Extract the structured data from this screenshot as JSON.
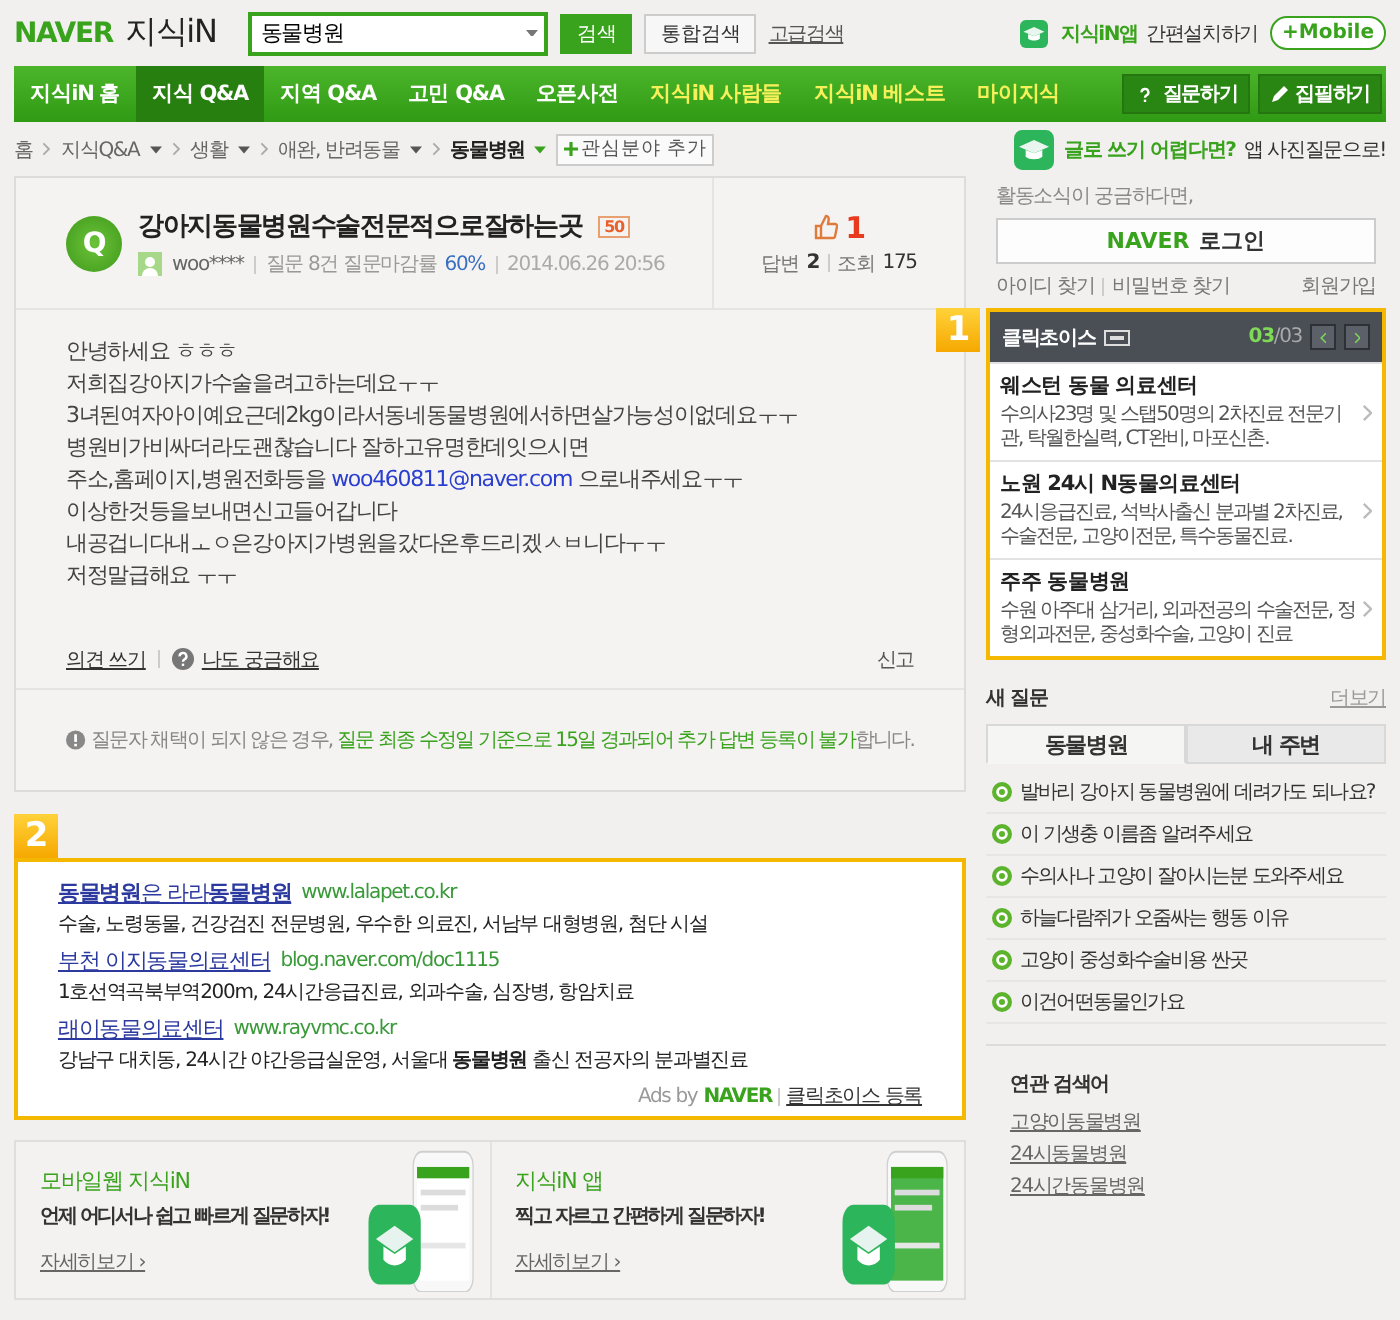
{
  "header": {
    "logo": "NAVER",
    "service": "지식iN",
    "search": {
      "value": "동물병원"
    },
    "search_button": "검색",
    "total_button": "통합검색",
    "advanced_link": "고급검색",
    "app_name": "지식iN앱",
    "app_install": "간편설치하기",
    "mobile": "+Mobile"
  },
  "nav": {
    "items": [
      {
        "label": "지식iN 홈",
        "selected": false,
        "highlighted": false
      },
      {
        "label": "지식 Q&A",
        "selected": true,
        "highlighted": false
      },
      {
        "label": "지역 Q&A",
        "selected": false,
        "highlighted": false
      },
      {
        "label": "고민 Q&A",
        "selected": false,
        "highlighted": false
      },
      {
        "label": "오픈사전",
        "selected": false,
        "highlighted": false
      },
      {
        "label": "지식iN 사람들",
        "selected": false,
        "highlighted": true
      },
      {
        "label": "지식iN 베스트",
        "selected": false,
        "highlighted": true
      },
      {
        "label": "마이지식",
        "selected": false,
        "highlighted": true
      }
    ],
    "actions": [
      {
        "kind": "ask",
        "label": "질문하기"
      },
      {
        "kind": "write",
        "label": "집필하기"
      }
    ]
  },
  "breadcrumb": {
    "items": [
      {
        "label": "홈",
        "dropdown": false,
        "selected": false
      },
      {
        "label": "지식Q&A",
        "dropdown": true,
        "selected": false
      },
      {
        "label": "생활",
        "dropdown": true,
        "selected": false
      },
      {
        "label": "애완, 반려동물",
        "dropdown": true,
        "selected": false
      },
      {
        "label": "동물병원",
        "dropdown": true,
        "selected": true
      }
    ],
    "add_interest": "관심분야 추가"
  },
  "app_tip": {
    "highlight": "글로 쓰기 어렵다면?",
    "text": "앱 사진질문으로!"
  },
  "question": {
    "icon_letter": "Q",
    "title": "강아지동물병원수술전문적으로잘하는곳",
    "points": "50",
    "user": "woo****",
    "stats_label": "질문 8건 질문마감률",
    "close_rate": "60%",
    "date": "2014.06.26 20:56",
    "likes": "1",
    "answers_label": "답변",
    "answers": "2",
    "views_label": "조회",
    "views": "175",
    "body": [
      [
        {
          "kind": "text",
          "text": "안녕하세요 ㅎㅎㅎ"
        }
      ],
      [
        {
          "kind": "text",
          "text": "저희집강아지가수술을려고하는데요ㅜㅜ"
        }
      ],
      [
        {
          "kind": "text",
          "text": "3녀된여자아이예요근데2kg이라서동네동물병원에서하면살가능성이없데요ㅜㅜ"
        }
      ],
      [
        {
          "kind": "text",
          "text": "병원비가비싸더라도괜찮습니다 잘하고유명한데잇으시면"
        }
      ],
      [
        {
          "kind": "text",
          "text": "주소,홈페이지,병원전화등을 "
        },
        {
          "kind": "link",
          "text": "woo460811@naver.com"
        },
        {
          "kind": "text",
          "text": " 으로내주세요ㅜㅜ"
        }
      ],
      [
        {
          "kind": "text",
          "text": "이상한것등을보내면신고들어갑니다"
        }
      ],
      [
        {
          "kind": "text",
          "text": "내공겁니다내ㅗㅇ은강아지가병원을갔다온후드리겠ㅅㅂ니다ㅜㅜ"
        }
      ],
      [
        {
          "kind": "text",
          "text": "저정말급해요 ㅜㅜ"
        }
      ]
    ],
    "comment_link": "의견 쓰기",
    "curious_link": "나도 궁금해요",
    "report": "신고",
    "notice": {
      "text": "질문자 채택이 되지 않은 경우, ",
      "highlight": "질문 최종 수정일 기준으로 15일 경과되어 추가 답변 등록이 불가",
      "end": "합니다."
    }
  },
  "login": {
    "prompt": "활동소식이 궁금하다면,",
    "brand": "NAVER",
    "button": "로그인",
    "links": [
      "아이디 찾기",
      "비밀번호 찾기"
    ],
    "signup": "회원가입"
  },
  "clickchoice": {
    "marker": "1",
    "title": "클릭초이스",
    "page_current": "03",
    "page_total": "/03",
    "items": [
      {
        "title": "웨스턴 동물 의료센터",
        "desc": "수의사23명 및 스탭50명의 2차진료 전문기관, 탁월한실력, CT완비, 마포신촌."
      },
      {
        "title": "노원 24시 N동물의료센터",
        "desc": "24시응급진료, 석박사출신 분과별 2차진료, 수술전문, 고양이전문, 특수동물진료."
      },
      {
        "title": "주주 동물병원",
        "desc": "수원 아주대 삼거리, 외과전공의 수술전문, 정형외과전문, 중성화수술, 고양이 진료"
      }
    ]
  },
  "new_questions": {
    "title": "새 질문",
    "more": "더보기",
    "tabs": [
      {
        "label": "동물병원",
        "selected": true
      },
      {
        "label": "내 주변",
        "selected": false
      }
    ],
    "items": [
      "발바리 강아지 동물병원에 데려가도 되나요?",
      "이 기생충 이름좀 알려주세요",
      "수의사나 고양이 잘아시는분 도와주세요",
      "하늘다람쥐가 오줌싸는 행동 이유",
      "고양이 중성화수술비용 싼곳",
      "이건어떤동물인가요"
    ]
  },
  "related": {
    "title": "연관 검색어",
    "links": [
      "고양이동물병원",
      "24시동물병원",
      "24시간동물병원"
    ]
  },
  "ads": {
    "marker": "2",
    "items": [
      {
        "title": "**동물병원**은 라라**동물병원**",
        "url": "www.lalapet.co.kr",
        "desc": "수술, 노령동물, 건강검진 전문병원, 우수한 의료진, 서남부 대형병원, 첨단 시설"
      },
      {
        "title": "부천 이지동물의료센터",
        "url": "blog.naver.com/doc1115",
        "desc": "1호선역곡북부역200m, 24시간응급진료, 외과수술, 심장병, 항암치료"
      },
      {
        "title": "래이동물의료센터",
        "url": "www.rayvmc.co.kr",
        "desc": "강남구 대치동, 24시간 야간응급실운영, 서울대 **동물병원** 출신 전공자의 분과별진료"
      }
    ],
    "ads_by": "Ads by",
    "brand": "NAVER",
    "register": "클릭초이스 등록"
  },
  "promos": [
    {
      "title": "모바일웹 지식iN",
      "text": "언제 어디서나 쉽고 빠르게 질문하자!",
      "more": "자세히보기 ›"
    },
    {
      "title": "지식iN 앱",
      "text": "찍고 자르고 간편하게 질문하자!",
      "more": "자세히보기 ›"
    }
  ]
}
